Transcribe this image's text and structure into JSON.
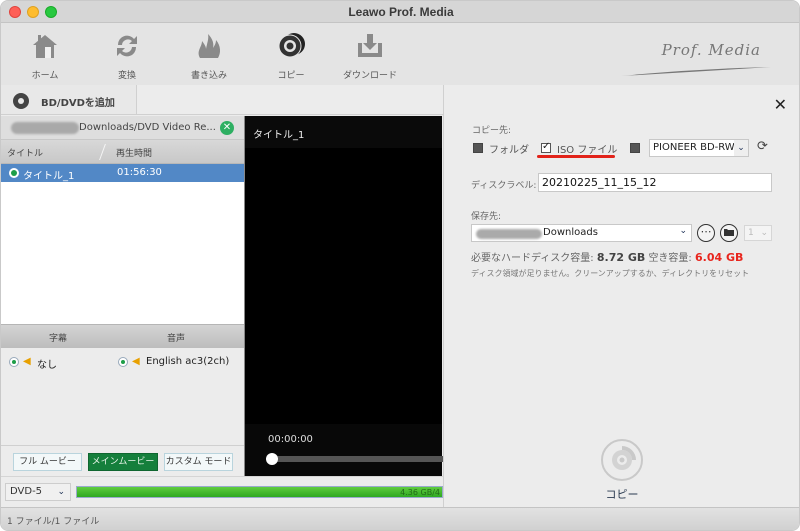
{
  "window": {
    "title": "Leawo Prof. Media"
  },
  "toolbar": {
    "items": [
      {
        "label": "ホーム",
        "icon": "home-icon"
      },
      {
        "label": "変換",
        "icon": "convert-icon"
      },
      {
        "label": "書き込み",
        "icon": "burn-icon"
      },
      {
        "label": "コピー",
        "icon": "copy-disc-icon",
        "active": true
      },
      {
        "label": "ダウンロード",
        "icon": "download-icon"
      }
    ],
    "brand": "Prof. Media"
  },
  "left_panel": {
    "add_button": "BD/DVDを追加",
    "source_path": "Downloads/DVD Video Re...",
    "title_list": {
      "columns": [
        "タイトル",
        "再生時間"
      ],
      "rows": [
        {
          "title": "タイトル_1",
          "duration": "01:56:30",
          "selected": true
        }
      ]
    },
    "subtitle_audio": {
      "headers": [
        "字幕",
        "音声"
      ],
      "subtitle": "なし",
      "audio": "English ac3(2ch)"
    },
    "modes": [
      {
        "label": "フル ムービー",
        "active": false
      },
      {
        "label": "メインムービー",
        "active": true
      },
      {
        "label": "カスタム モード",
        "active": false
      }
    ]
  },
  "video": {
    "title": "タイトル_1",
    "time": "00:00:00",
    "position": 0
  },
  "bottom": {
    "disc_type": "DVD-5",
    "progress_label": "4.36 GB/4",
    "progress_fraction": 1.0,
    "status": "1 ファイル/1 ファイル"
  },
  "right_panel": {
    "copy_to_label": "コピー先:",
    "targets": [
      {
        "label": "フォルダ",
        "checked": false
      },
      {
        "label": "ISO ファイル",
        "checked": true
      },
      {
        "label": "",
        "checked": false
      }
    ],
    "drive": "PIONEER BD-RW",
    "disc_label_label": "ディスクラベル:",
    "disc_label_value": "20210225_11_15_12",
    "save_to_label": "保存先:",
    "save_path": "Downloads",
    "copies": "1",
    "required_label": "必要なハードディスク容量:",
    "required_value": "8.72 GB",
    "free_label": "空き容量:",
    "free_value": "6.04 GB",
    "warning": "ディスク領域が足りません。クリーンアップするか、ディレクトリをリセット",
    "copy_button": "コピー",
    "colors": {
      "free_space_warning": "#e8251d",
      "iso_underline": "#e2231a",
      "active_mode": "#157f3c",
      "selection": "#5288c6"
    }
  }
}
